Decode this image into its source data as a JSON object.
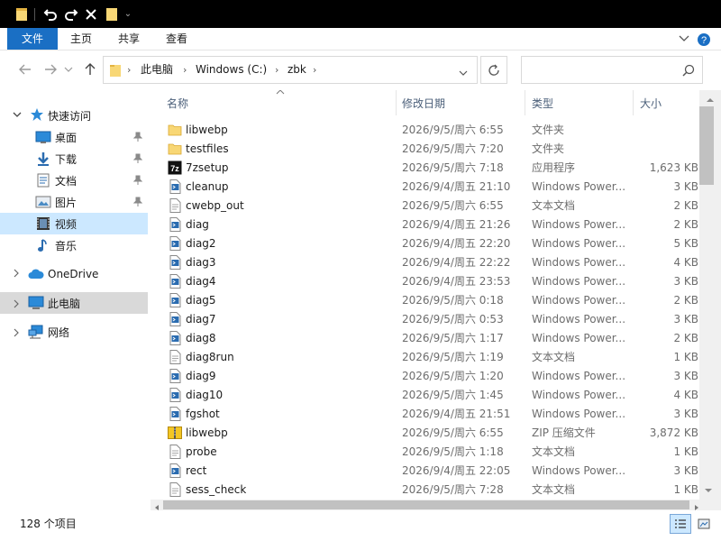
{
  "ribbon": {
    "tabs": [
      "文件",
      "主页",
      "共享",
      "查看"
    ]
  },
  "address": {
    "path": [
      "此电脑",
      "Windows (C:)",
      "zbk"
    ],
    "search_placeholder": ""
  },
  "nav": {
    "quick_access": "快速访问",
    "items": [
      {
        "label": "桌面",
        "icon": "desktop-icon",
        "pinned": true
      },
      {
        "label": "下载",
        "icon": "download-icon",
        "pinned": true
      },
      {
        "label": "文档",
        "icon": "documents-icon",
        "pinned": true
      },
      {
        "label": "图片",
        "icon": "pictures-icon",
        "pinned": true
      },
      {
        "label": "视频",
        "icon": "videos-icon",
        "pinned": false
      },
      {
        "label": "音乐",
        "icon": "music-icon",
        "pinned": false
      }
    ],
    "onedrive": "OneDrive",
    "this_pc": "此电脑",
    "network": "网络"
  },
  "columns": {
    "name": "名称",
    "date": "修改日期",
    "type": "类型",
    "size": "大小"
  },
  "files": [
    {
      "name": "libwebp",
      "date": "2026/9/5/周六 6:55",
      "type": "文件夹",
      "size": "",
      "icon": "folder"
    },
    {
      "name": "testfiles",
      "date": "2026/9/5/周六 7:20",
      "type": "文件夹",
      "size": "",
      "icon": "folder"
    },
    {
      "name": "7zsetup",
      "date": "2026/9/5/周六 7:18",
      "type": "应用程序",
      "size": "1,623 KB",
      "icon": "exe"
    },
    {
      "name": "cleanup",
      "date": "2026/9/4/周五 21:10",
      "type": "Windows Power...",
      "size": "3 KB",
      "icon": "ps"
    },
    {
      "name": "cwebp_out",
      "date": "2026/9/5/周六 6:55",
      "type": "文本文档",
      "size": "2 KB",
      "icon": "txt"
    },
    {
      "name": "diag",
      "date": "2026/9/4/周五 21:26",
      "type": "Windows Power...",
      "size": "2 KB",
      "icon": "ps"
    },
    {
      "name": "diag2",
      "date": "2026/9/4/周五 22:20",
      "type": "Windows Power...",
      "size": "5 KB",
      "icon": "ps"
    },
    {
      "name": "diag3",
      "date": "2026/9/4/周五 22:22",
      "type": "Windows Power...",
      "size": "4 KB",
      "icon": "ps"
    },
    {
      "name": "diag4",
      "date": "2026/9/4/周五 23:53",
      "type": "Windows Power...",
      "size": "3 KB",
      "icon": "ps"
    },
    {
      "name": "diag5",
      "date": "2026/9/5/周六 0:18",
      "type": "Windows Power...",
      "size": "2 KB",
      "icon": "ps"
    },
    {
      "name": "diag7",
      "date": "2026/9/5/周六 0:53",
      "type": "Windows Power...",
      "size": "3 KB",
      "icon": "ps"
    },
    {
      "name": "diag8",
      "date": "2026/9/5/周六 1:17",
      "type": "Windows Power...",
      "size": "2 KB",
      "icon": "ps"
    },
    {
      "name": "diag8run",
      "date": "2026/9/5/周六 1:19",
      "type": "文本文档",
      "size": "1 KB",
      "icon": "txt"
    },
    {
      "name": "diag9",
      "date": "2026/9/5/周六 1:20",
      "type": "Windows Power...",
      "size": "3 KB",
      "icon": "ps"
    },
    {
      "name": "diag10",
      "date": "2026/9/5/周六 1:45",
      "type": "Windows Power...",
      "size": "4 KB",
      "icon": "ps"
    },
    {
      "name": "fgshot",
      "date": "2026/9/4/周五 21:51",
      "type": "Windows Power...",
      "size": "3 KB",
      "icon": "ps"
    },
    {
      "name": "libwebp",
      "date": "2026/9/5/周六 6:55",
      "type": "ZIP 压缩文件",
      "size": "3,872 KB",
      "icon": "zip"
    },
    {
      "name": "probe",
      "date": "2026/9/5/周六 1:18",
      "type": "文本文档",
      "size": "1 KB",
      "icon": "txt"
    },
    {
      "name": "rect",
      "date": "2026/9/4/周五 22:05",
      "type": "Windows Power...",
      "size": "3 KB",
      "icon": "ps"
    },
    {
      "name": "sess_check",
      "date": "2026/9/5/周六 7:28",
      "type": "文本文档",
      "size": "1 KB",
      "icon": "txt"
    }
  ],
  "status": {
    "item_count": "128 个项目"
  },
  "colors": {
    "accent": "#1a6fc4",
    "selection": "#cce8ff",
    "folder": "#f8d775",
    "ps_blue": "#2b6cb0"
  }
}
